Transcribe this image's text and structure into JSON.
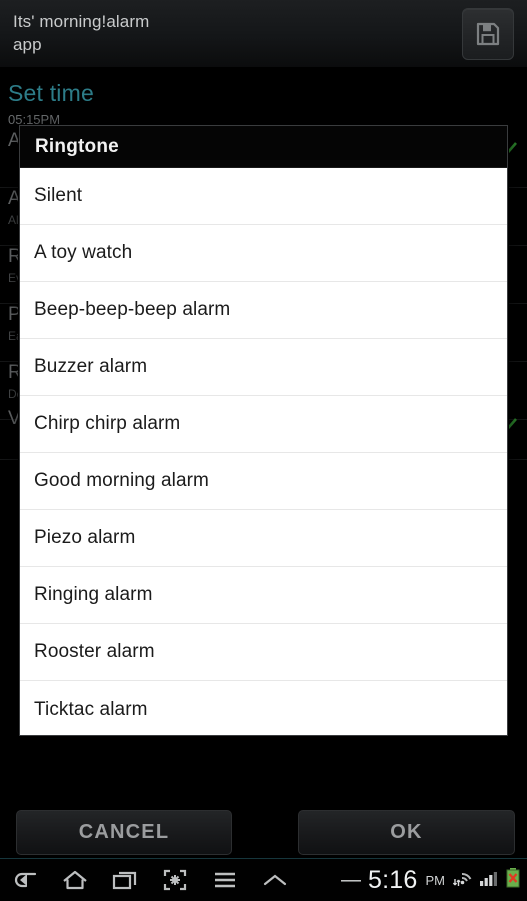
{
  "titlebar": {
    "app_title": "Its' morning!alarm\napp",
    "save_icon": "floppy-disk-save-icon"
  },
  "background": {
    "section_title": "Set time",
    "section_subtitle": "05:15PM",
    "rows": [
      {
        "main": "Active",
        "sub": "",
        "checked": true
      },
      {
        "main": "Alarm name",
        "sub": "Alarm",
        "checked": false
      },
      {
        "main": "Repeat",
        "sub": "Every day",
        "checked": false
      },
      {
        "main": "Powernap",
        "sub": "Easy",
        "checked": false
      },
      {
        "main": "Ringtone",
        "sub": "Default",
        "checked": false
      },
      {
        "main": "Vibrate",
        "sub": "",
        "checked": true
      }
    ]
  },
  "dialog": {
    "title": "Ringtone",
    "items": [
      "Silent",
      "A toy watch",
      "Beep-beep-beep alarm",
      "Buzzer alarm",
      "Chirp chirp alarm",
      "Good morning alarm",
      "Piezo alarm",
      "Ringing alarm",
      "Rooster alarm",
      "Ticktac alarm"
    ]
  },
  "actions": {
    "cancel_label": "CANCEL",
    "ok_label": "OK"
  },
  "navbar": {
    "icons": [
      "back-icon",
      "home-icon",
      "recent-apps-icon",
      "screenshot-capture-icon",
      "menu-icon",
      "chevron-up-icon"
    ],
    "status": {
      "dash": "—",
      "time": "5:16",
      "ampm": "PM",
      "wifi_icon": "wifi-signal-icon",
      "cellular_icon": "cellular-signal-icon",
      "battery_icon": "battery-error-icon"
    }
  },
  "colors": {
    "accent_teal": "#2d7c88",
    "check_green": "#2f8f2f",
    "dialog_bg": "#ffffff",
    "titlebar_bg": "#17191b"
  }
}
